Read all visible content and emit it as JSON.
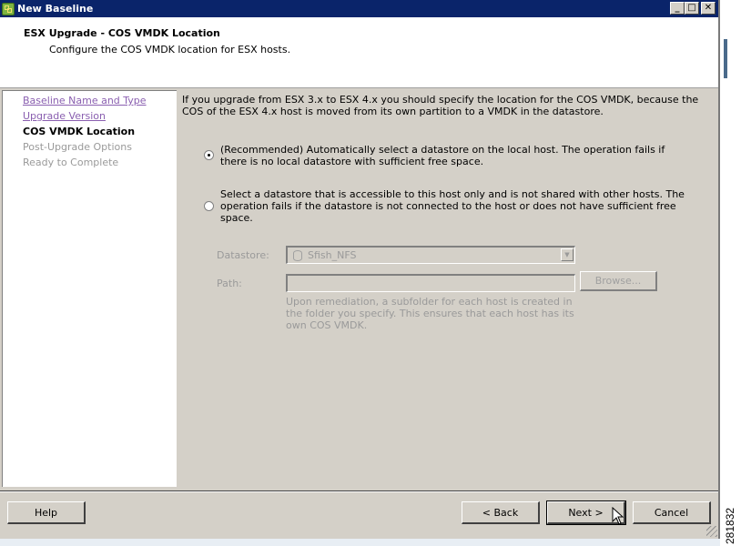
{
  "window": {
    "title": "New Baseline",
    "controls": {
      "minimize": "_",
      "maximize": "□",
      "close": "✕"
    }
  },
  "header": {
    "title": "ESX Upgrade - COS VMDK Location",
    "subtitle": "Configure the COS VMDK location for ESX hosts."
  },
  "steps": [
    {
      "label": "Baseline Name and Type",
      "state": "visited"
    },
    {
      "label": "Upgrade Version",
      "state": "visited"
    },
    {
      "label": "COS VMDK Location",
      "state": "current"
    },
    {
      "label": "Post-Upgrade Options",
      "state": "disabled"
    },
    {
      "label": "Ready to Complete",
      "state": "disabled"
    }
  ],
  "content": {
    "intro": "If you upgrade from ESX 3.x to ESX 4.x you should specify the location for the COS VMDK, because the COS of the ESX 4.x host is moved from its own partition to a VMDK in the datastore.",
    "options": [
      {
        "label": "(Recommended) Automatically select a datastore on the local host. The operation fails if there is no local datastore with sufficient free space.",
        "checked": true
      },
      {
        "label": "Select a datastore that is accessible to this host only and is not shared with other hosts. The operation fails if the datastore is not connected to the host or does not have sufficient free space.",
        "checked": false
      }
    ],
    "datastore_label": "Datastore:",
    "datastore_value": "Sfish_NFS",
    "path_label": "Path:",
    "path_value": "",
    "browse_label": "Browse...",
    "path_hint": "Upon remediation, a subfolder for each host is created in the folder you specify. This ensures that each host has its own COS VMDK."
  },
  "footer": {
    "help": "Help",
    "back": "< Back",
    "next": "Next >",
    "cancel": "Cancel"
  },
  "figure_id": "281832"
}
